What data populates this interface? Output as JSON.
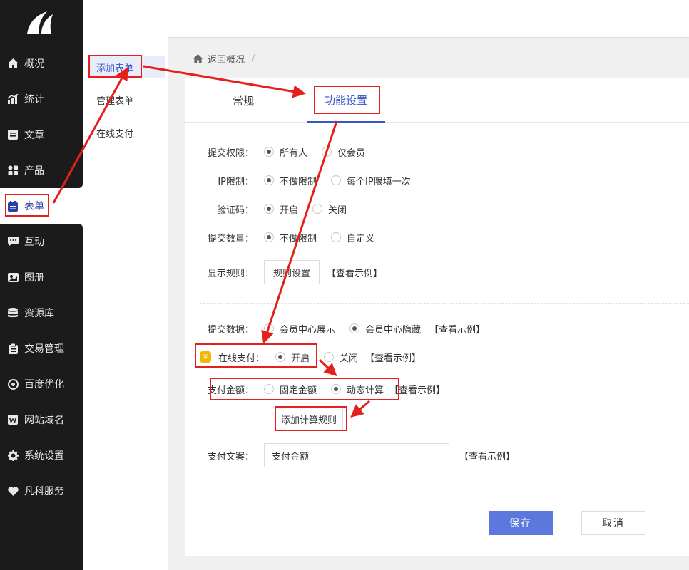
{
  "sidebar": {
    "items": [
      {
        "label": "概况",
        "icon": "home-icon"
      },
      {
        "label": "统计",
        "icon": "chart-icon"
      },
      {
        "label": "文章",
        "icon": "article-icon"
      },
      {
        "label": "产品",
        "icon": "grid-icon"
      },
      {
        "label": "表单",
        "icon": "calendar-icon"
      },
      {
        "label": "互动",
        "icon": "chat-icon"
      },
      {
        "label": "图册",
        "icon": "image-icon"
      },
      {
        "label": "资源库",
        "icon": "database-icon"
      },
      {
        "label": "交易管理",
        "icon": "clipboard-icon"
      },
      {
        "label": "百度优化",
        "icon": "target-icon"
      },
      {
        "label": "网站域名",
        "icon": "w-icon"
      },
      {
        "label": "系统设置",
        "icon": "gear-icon"
      },
      {
        "label": "凡科服务",
        "icon": "heart-icon"
      }
    ]
  },
  "submenu": {
    "items": [
      "添加表单",
      "管理表单",
      "在线支付"
    ]
  },
  "breadcrumb": {
    "back": "返回概况",
    "sep": "/"
  },
  "tabs": {
    "general": "常规",
    "features": "功能设置"
  },
  "form": {
    "submit_perm": {
      "label": "提交权限：",
      "opt1": "所有人",
      "opt2": "仅会员"
    },
    "ip_limit": {
      "label": "IP限制：",
      "opt1": "不做限制",
      "opt2": "每个IP限填一次"
    },
    "captcha": {
      "label": "验证码：",
      "opt1": "开启",
      "opt2": "关闭"
    },
    "submit_count": {
      "label": "提交数量：",
      "opt1": "不做限制",
      "opt2": "自定义"
    },
    "display_rule": {
      "label": "显示规则：",
      "button": "规则设置",
      "example": "【查看示例】"
    },
    "submit_data": {
      "label": "提交数据：",
      "opt1": "会员中心展示",
      "opt2": "会员中心隐藏",
      "example": "【查看示例】"
    },
    "online_pay": {
      "label": "在线支付：",
      "opt1": "开启",
      "opt2": "关闭",
      "example": "【查看示例】"
    },
    "pay_amount": {
      "label": "支付金额：",
      "opt1": "固定金额",
      "opt2": "动态计算",
      "example": "【查看示例】"
    },
    "add_rule": "添加计算规则",
    "pay_text": {
      "label": "支付文案：",
      "value": "支付金额",
      "example": "【查看示例】"
    }
  },
  "actions": {
    "save": "保存",
    "cancel": "取消"
  },
  "colors": {
    "accent": "#3b56c6",
    "annotation": "#e3201b",
    "sidebar_bg": "#1b1b1b"
  }
}
